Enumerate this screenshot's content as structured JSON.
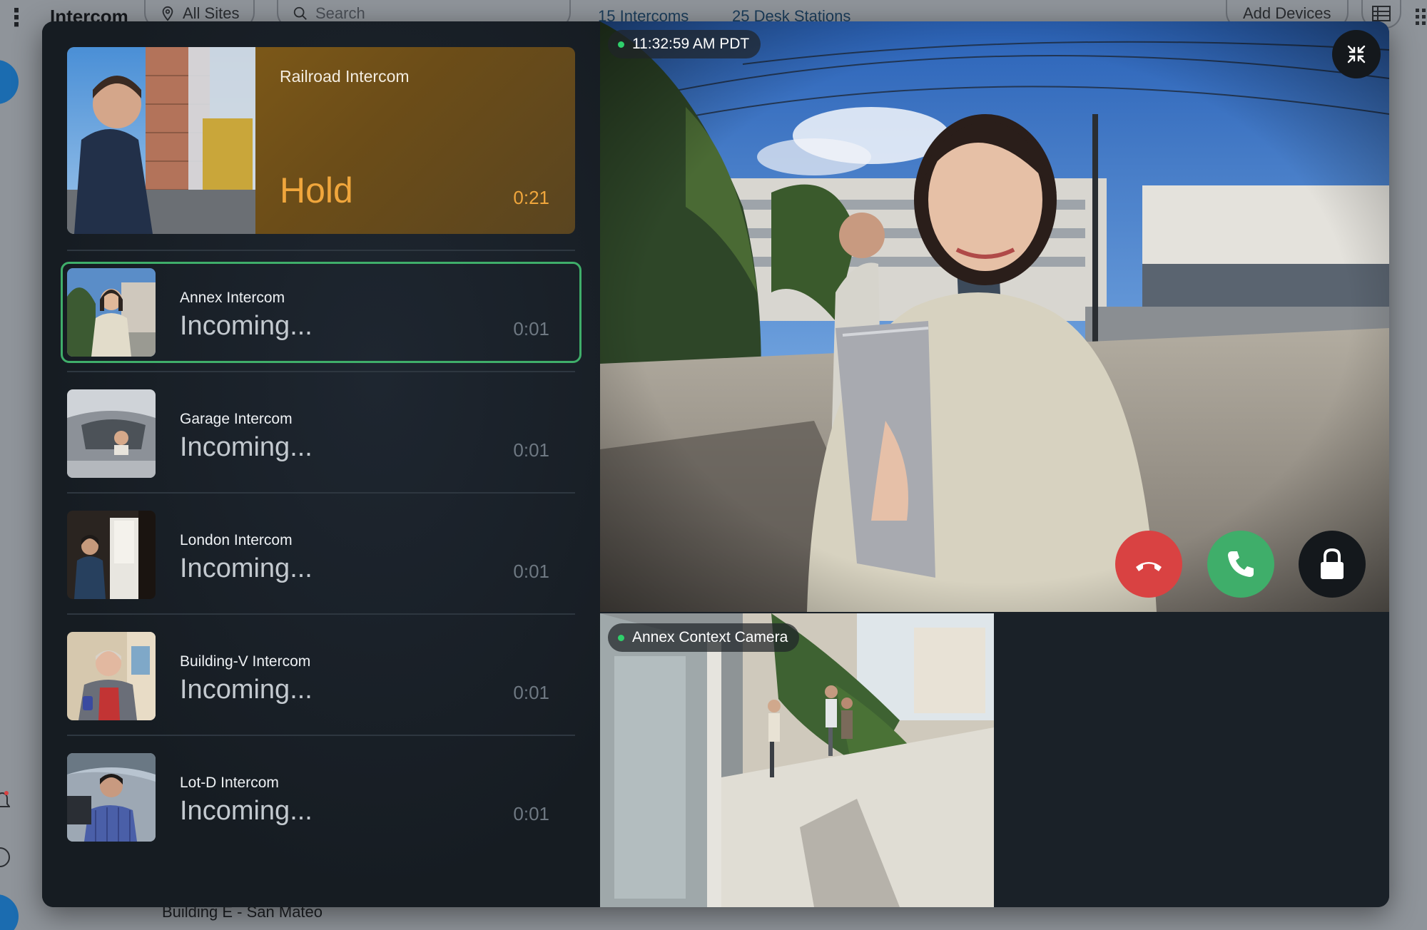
{
  "background_app": {
    "title": "Intercom",
    "site_filter": "All Sites",
    "search_placeholder": "Search",
    "intercoms_count": "15",
    "intercoms_label": "Intercoms",
    "desk_stations_count": "25",
    "desk_stations_label": "Desk Stations",
    "add_devices_label": "Add Devices",
    "footer_location": "Building E - San Mateo"
  },
  "hold_call": {
    "name": "Railroad Intercom",
    "state": "Hold",
    "timer": "0:21"
  },
  "incoming_calls": [
    {
      "name": "Annex Intercom",
      "state": "Incoming...",
      "timer": "0:01",
      "selected": true
    },
    {
      "name": "Garage Intercom",
      "state": "Incoming...",
      "timer": "0:01",
      "selected": false
    },
    {
      "name": "London Intercom",
      "state": "Incoming...",
      "timer": "0:01",
      "selected": false
    },
    {
      "name": "Building-V Intercom",
      "state": "Incoming...",
      "timer": "0:01",
      "selected": false
    },
    {
      "name": "Lot-D Intercom",
      "state": "Incoming...",
      "timer": "0:01",
      "selected": false
    }
  ],
  "main_video": {
    "timestamp": "11:32:59 AM PDT",
    "live_indicator_color": "#2fd06b"
  },
  "context_video": {
    "label": "Annex Context Camera"
  },
  "controls": {
    "decline_color": "#d94242",
    "accept_color": "#3fae6a",
    "unlock_color": "#14181c",
    "collapse_icon": "collapse-arrows-icon"
  },
  "colors": {
    "hold_accent": "#f0a63c",
    "selected_border": "#3fae6a",
    "modal_bg": "#1a2128"
  }
}
